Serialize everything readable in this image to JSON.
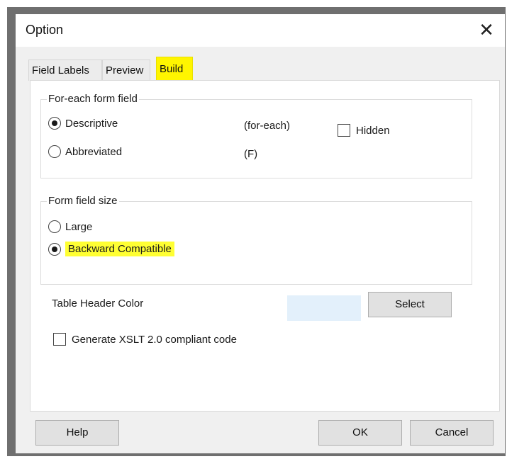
{
  "dialog": {
    "title": "Option",
    "close_glyph": "✕"
  },
  "tabs": [
    {
      "label": "Field Labels",
      "active": false
    },
    {
      "label": "Preview",
      "active": false
    },
    {
      "label": "Build",
      "active": true
    }
  ],
  "foreach_group": {
    "label": "For-each form field",
    "options": [
      {
        "label": "Descriptive",
        "checked": true,
        "note": "(for-each)"
      },
      {
        "label": "Abbreviated",
        "checked": false,
        "note": "(F)"
      }
    ],
    "hidden_checkbox": {
      "label": "Hidden",
      "checked": false
    }
  },
  "size_group": {
    "label": "Form field size",
    "options": [
      {
        "label": "Large",
        "checked": false
      },
      {
        "label": "Backward Compatible",
        "checked": true
      }
    ]
  },
  "table_header": {
    "label": "Table Header Color",
    "color": "#e3f0fb",
    "select_label": "Select"
  },
  "xslt_checkbox": {
    "label": "Generate XSLT 2.0 compliant code",
    "checked": false
  },
  "footer": {
    "help_label": "Help",
    "ok_label": "OK",
    "cancel_label": "Cancel"
  },
  "colors": {
    "highlight": "#ffff33",
    "background": "#f0f0f0"
  }
}
